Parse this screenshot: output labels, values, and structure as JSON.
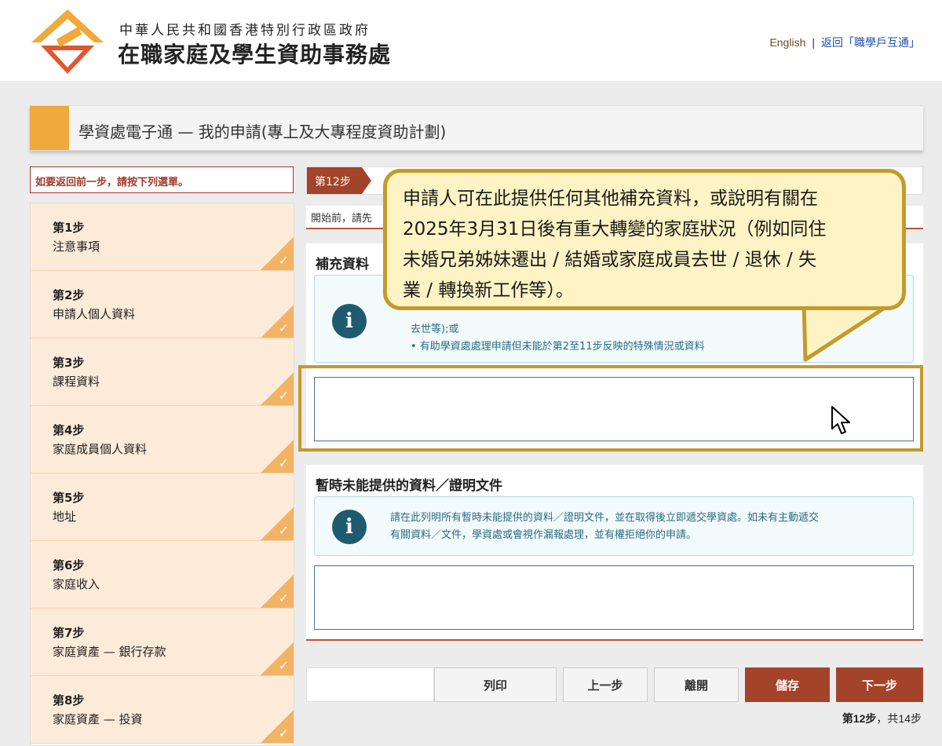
{
  "header": {
    "gov_line1": "中華人民共和國香港特別行政區政府",
    "gov_line2": "在職家庭及學生資助事務處",
    "english_link": "English",
    "separator": "|",
    "back_link": "返回「職學戶互通」"
  },
  "page_title": "學資處電子通 — 我的申請(專上及大專程度資助計劃)",
  "nav": {
    "hint": "如要返回前一步，請按下列選單。",
    "items": [
      {
        "step": "第1步",
        "label": "注意事項"
      },
      {
        "step": "第2步",
        "label": "申請人個人資料"
      },
      {
        "step": "第3步",
        "label": "課程資料"
      },
      {
        "step": "第4步",
        "label": "家庭成員個人資料"
      },
      {
        "step": "第5步",
        "label": "地址"
      },
      {
        "step": "第6步",
        "label": "家庭收入"
      },
      {
        "step": "第7步",
        "label": "家庭資產 — 銀行存款"
      },
      {
        "step": "第8步",
        "label": "家庭資產 — 投資"
      }
    ],
    "check_glyph": "✓"
  },
  "step_badge": "第12步",
  "intro_text": "開始前，請先",
  "section1": {
    "title": "補充資料",
    "info_lines": [
      "去世等);或",
      "• 有助學資處處理申請但未能於第2至11步反映的特殊情況或資料"
    ],
    "textarea_value": ""
  },
  "section2": {
    "title": "暫時未能提供的資料／證明文件",
    "info_lines": [
      "請在此列明所有暫時未能提供的資料／證明文件，並在取得後立即遞交學資處。如未有主動遞交",
      "有關資料／文件，學資處或會視作漏報處理，並有權拒絕你的申請。"
    ],
    "textarea_value": ""
  },
  "info_icon_glyph": "i",
  "buttons": {
    "print": "列印",
    "prev": "上一步",
    "leave": "離開",
    "save": "儲存",
    "next": "下一步"
  },
  "page_count": {
    "current": "第12步",
    "sep": "，",
    "total": "共14步"
  },
  "callout_lines": [
    "申請人可在此提供任何其他補充資料，或說明有關在",
    "2025年3月31日後有重大轉變的家庭狀況（例如同住",
    "未婚兄弟姊妹遷出 / 結婚或家庭成員去世 / 退休 / 失",
    "業 / 轉換新工作等）。"
  ],
  "colors": {
    "brand_orange": "#f0a93b",
    "brand_red": "#a3432a",
    "info_blue": "#1f5b70",
    "callout_fill": "#fdf3c4",
    "callout_border": "#c49a2b"
  }
}
